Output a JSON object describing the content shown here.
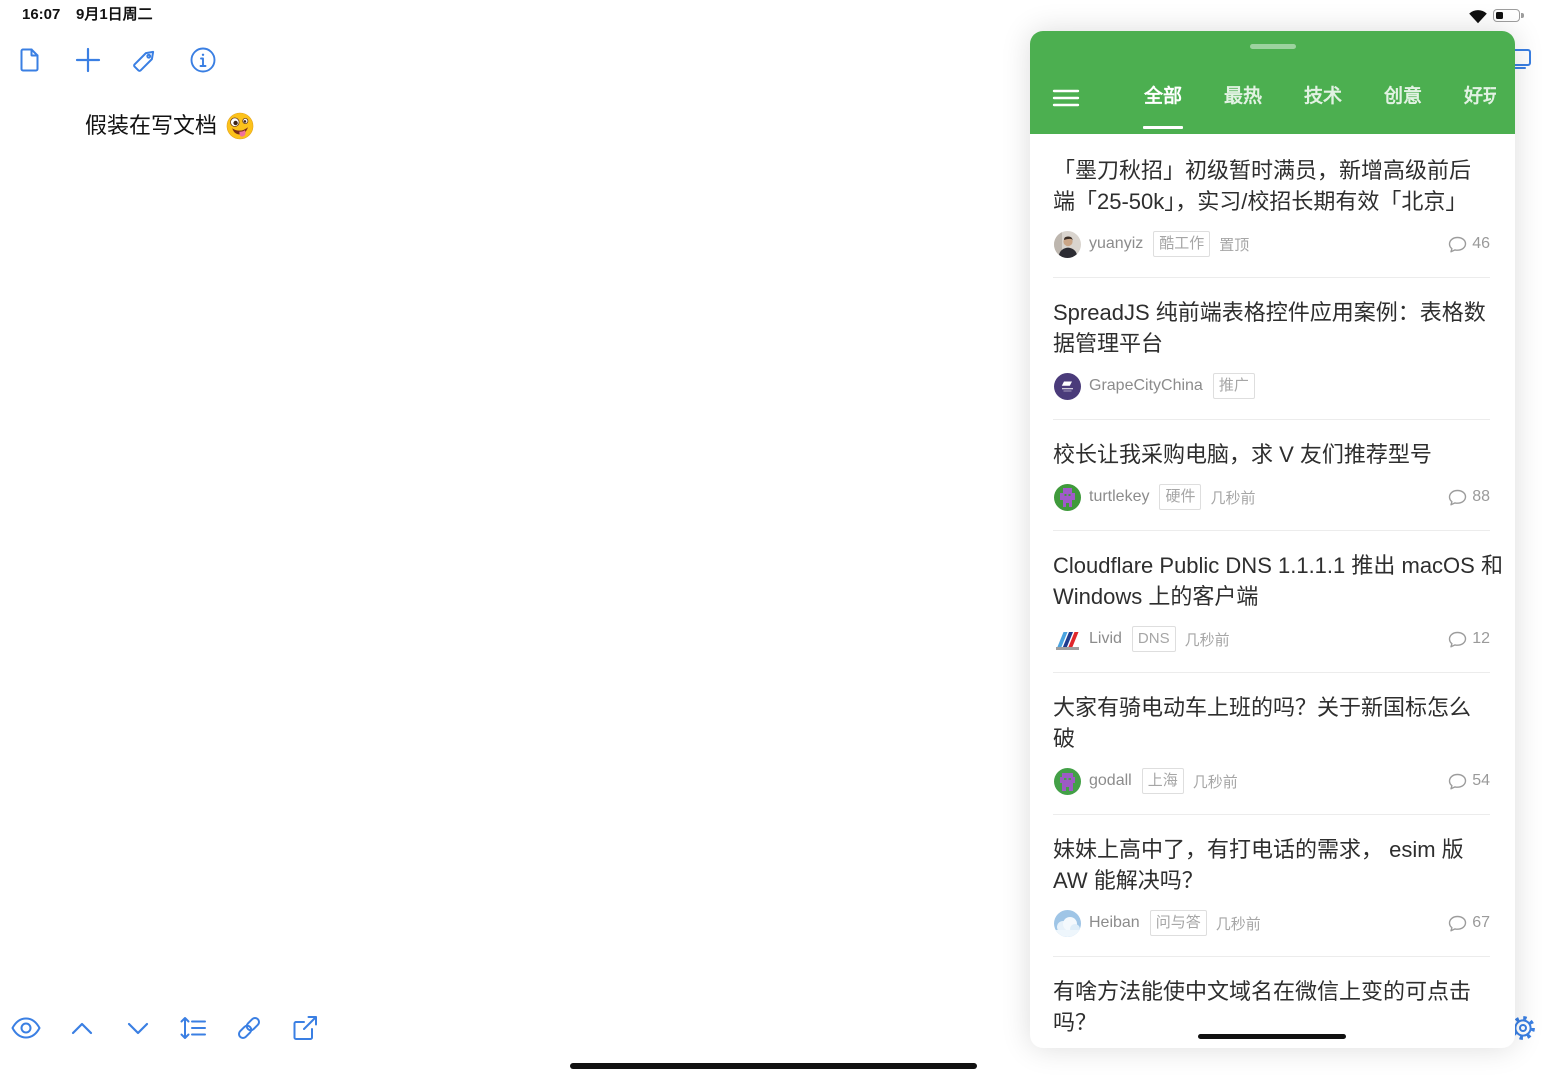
{
  "status_bar": {
    "time": "16:07",
    "date": "9月1日周二",
    "wifi_icon": "wifi-icon",
    "battery_icon": "battery-icon",
    "battery_level": 0.35
  },
  "editor": {
    "accent_color": "#3a7fe3",
    "top_toolbar": [
      {
        "icon": "document-icon"
      },
      {
        "icon": "plus-icon"
      },
      {
        "icon": "tag-icon"
      },
      {
        "icon": "info-icon"
      }
    ],
    "text": "假装在写文档",
    "emoji_icon": "zany-face-emoji",
    "bottom_toolbar": [
      {
        "icon": "eye-icon"
      },
      {
        "icon": "chevron-up-icon"
      },
      {
        "icon": "chevron-down-icon"
      },
      {
        "icon": "line-spacing-icon"
      },
      {
        "icon": "link-icon"
      },
      {
        "icon": "share-icon"
      }
    ],
    "edge_icons": [
      {
        "icon": "split-view-icon"
      },
      {
        "icon": "gear-icon"
      }
    ]
  },
  "slide_over": {
    "header_color": "#4caf50",
    "menu_icon": "hamburger-menu-icon",
    "tabs": [
      {
        "label": "全部",
        "selected": true
      },
      {
        "label": "最热",
        "selected": false
      },
      {
        "label": "技术",
        "selected": false
      },
      {
        "label": "创意",
        "selected": false
      },
      {
        "label": "好玩",
        "selected": false
      }
    ],
    "reply_icon": "comment-bubble-icon",
    "items": [
      {
        "title_lines": [
          "「墨刀秋招」初级暂时满员，新增高级前后",
          "端「25-50k」，实习/校招长期有效「北京」"
        ],
        "author": "yuanyiz",
        "avatar_icon": "portrait-avatar",
        "node": "酷工作",
        "extra": "置顶",
        "replies": "46"
      },
      {
        "title_lines": [
          "SpreadJS 纯前端表格控件应用案例：表格数",
          "据管理平台"
        ],
        "author": "GrapeCityChina",
        "avatar_icon": "grapecity-logo-avatar",
        "node": "推广"
      },
      {
        "title_lines": [
          "校长让我采购电脑，求 V 友们推荐型号"
        ],
        "author": "turtlekey",
        "avatar_icon": "pixel-avatar",
        "node": "硬件",
        "extra": "几秒前",
        "replies": "88"
      },
      {
        "title_lines": [
          "Cloudflare Public DNS 1.1.1.1 推出 macOS 和",
          "Windows 上的客户端"
        ],
        "author": "Livid",
        "avatar_icon": "stripes-avatar",
        "node": "DNS",
        "extra": "几秒前",
        "replies": "12"
      },
      {
        "title_lines": [
          "大家有骑电动车上班的吗？关于新国标怎么",
          "破"
        ],
        "author": "godall",
        "avatar_icon": "pixel-avatar",
        "node": "上海",
        "extra": "几秒前",
        "replies": "54"
      },
      {
        "title_lines": [
          "妹妹上高中了，有打电话的需求， esim 版",
          "AW 能解决吗？"
        ],
        "author": "Heiban",
        "avatar_icon": "cloud-avatar",
        "node": "问与答",
        "extra": "几秒前",
        "replies": "67"
      },
      {
        "title_lines": [
          "有啥方法能使中文域名在微信上变的可点击",
          "吗？"
        ]
      }
    ]
  }
}
